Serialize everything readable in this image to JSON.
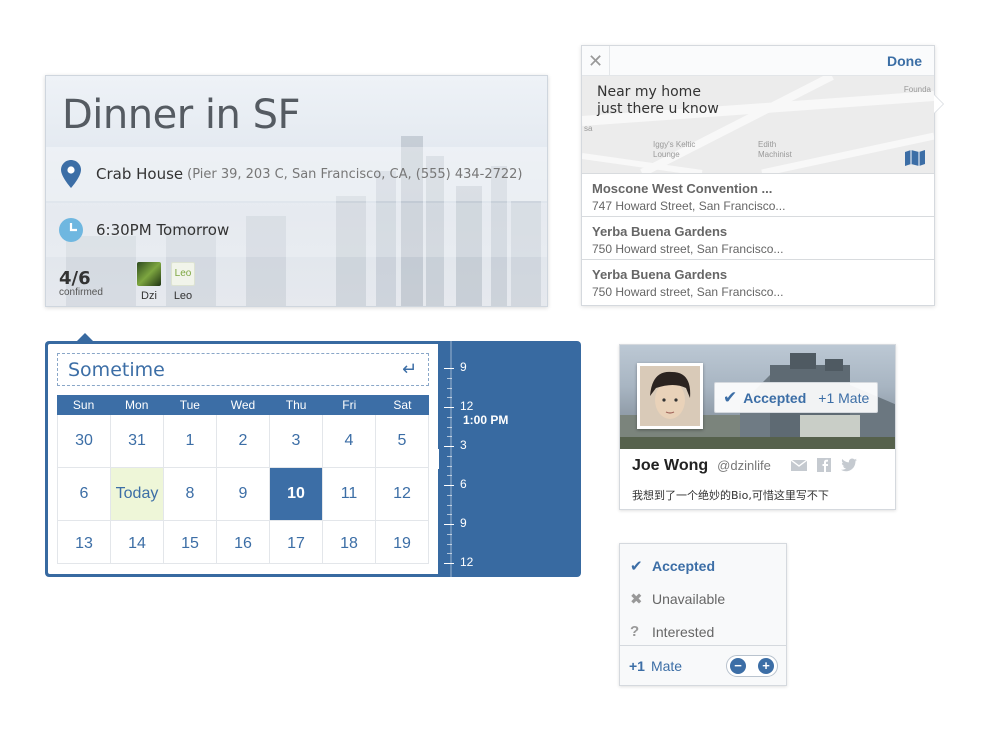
{
  "event": {
    "title": "Dinner in SF",
    "location_name": "Crab House",
    "location_detail": "(Pier 39, 203 C, San Francisco, CA, (555) 434-2722)",
    "time": "6:30PM Tomorrow",
    "confirmed_count": "4/6",
    "confirmed_label": "confirmed",
    "attendees": [
      {
        "name": "Dzi"
      },
      {
        "name": "Leo",
        "avatar_text": "Leo"
      }
    ]
  },
  "location_picker": {
    "done_label": "Done",
    "close_icon": "close-icon",
    "note_line1": "Near my home",
    "note_line2": "just there u know",
    "map_labels": [
      "Founda",
      "sa",
      "Iggy's Keltic Lounge",
      "Edith Machinist"
    ],
    "results": [
      {
        "name": "Moscone West Convention ...",
        "address": "747 Howard Street, San Francisco..."
      },
      {
        "name": "Yerba Buena Gardens",
        "address": "750 Howard street, San Francisco..."
      },
      {
        "name": "Yerba Buena Gardens",
        "address": "750 Howard street, San Francisco..."
      }
    ]
  },
  "datetime_picker": {
    "sometime_text": "Sometime",
    "weekdays": [
      "Sun",
      "Mon",
      "Tue",
      "Wed",
      "Thu",
      "Fri",
      "Sat"
    ],
    "days": [
      "30",
      "31",
      "1",
      "2",
      "3",
      "4",
      "5",
      "6",
      "Today",
      "8",
      "9",
      "10",
      "11",
      "12",
      "13",
      "14",
      "15",
      "16",
      "17",
      "18",
      "19"
    ],
    "today_index": 8,
    "selected_index": 11,
    "time_ticks": [
      "9",
      "12",
      "3",
      "6",
      "9",
      "12"
    ],
    "current_time": "1:00 PM"
  },
  "profile": {
    "name": "Joe Wong",
    "handle": "@dzinlife",
    "bio": "我想到了一个绝妙的Bio,可惜这里写不下",
    "status": "Accepted",
    "plus_mate": "+1 Mate"
  },
  "rsvp": {
    "options": [
      {
        "label": "Accepted",
        "icon": "check-icon",
        "glyph": "✔"
      },
      {
        "label": "Unavailable",
        "icon": "x-icon",
        "glyph": "✖"
      },
      {
        "label": "Interested",
        "icon": "question-icon",
        "glyph": "?"
      }
    ],
    "plus_label": "+1",
    "mate_label": "Mate"
  },
  "colors": {
    "accent": "#3c6ea6",
    "today_bg": "#eef6d8"
  }
}
